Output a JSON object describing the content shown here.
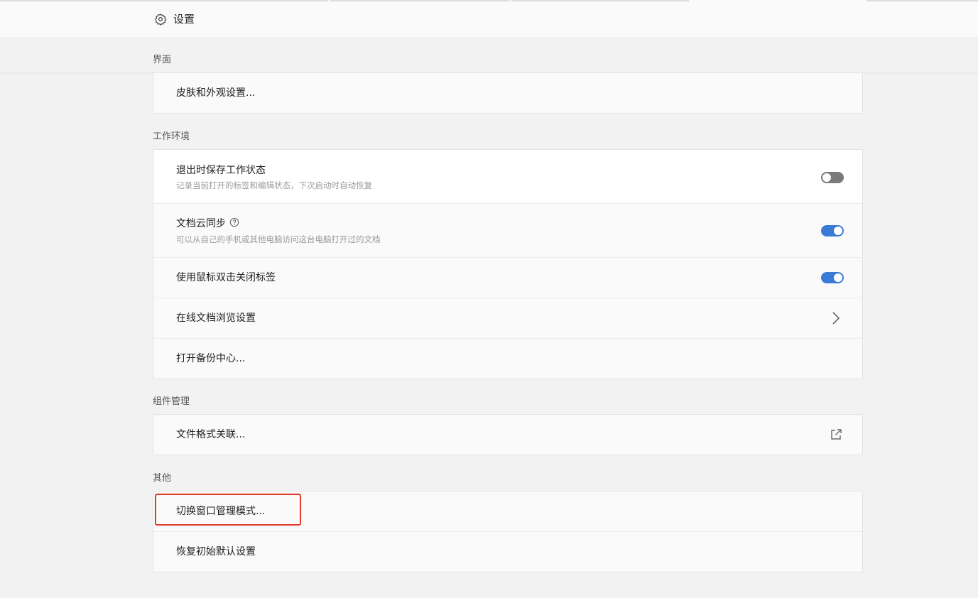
{
  "header": {
    "title": "设置",
    "icon": "gear-icon"
  },
  "colors": {
    "accent": "#3a7bd5",
    "highlight": "#e23a2a",
    "toggle_off": "#7a7a7a"
  },
  "sections": {
    "ui": {
      "label": "界面",
      "items": [
        {
          "label": "皮肤和外观设置..."
        }
      ]
    },
    "workspace": {
      "label": "工作环境",
      "items": [
        {
          "label": "退出时保存工作状态",
          "desc": "记录当前打开的标签和编辑状态，下次启动时自动恢复",
          "toggle": false
        },
        {
          "label": "文档云同步",
          "desc": "可以从自己的手机或其他电脑访问这台电脑打开过的文档",
          "toggle": true,
          "help_icon": "question-circle-icon"
        },
        {
          "label": "使用鼠标双击关闭标签",
          "toggle": true
        },
        {
          "label": "在线文档浏览设置",
          "icon": "chevron-right-icon"
        },
        {
          "label": "打开备份中心..."
        }
      ]
    },
    "components": {
      "label": "组件管理",
      "items": [
        {
          "label": "文件格式关联...",
          "icon": "external-link-icon"
        }
      ]
    },
    "other": {
      "label": "其他",
      "items": [
        {
          "label": "切换窗口管理模式...",
          "highlighted": true
        },
        {
          "label": "恢复初始默认设置"
        }
      ]
    }
  }
}
